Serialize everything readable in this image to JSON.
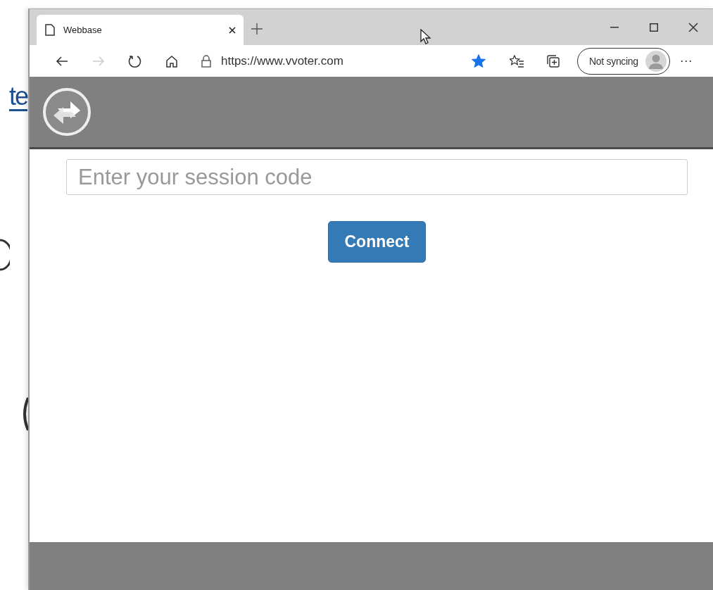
{
  "background_page": {
    "link_text": "te"
  },
  "browser": {
    "tabs": [
      {
        "title": "Webbase",
        "selected": true
      }
    ],
    "address": "https://www.vvoter.com",
    "favorite": true,
    "sync_button": "Not syncing",
    "more_button": "···"
  },
  "app": {
    "session_field": {
      "placeholder": "Enter your session code"
    },
    "connect_button": "Connect"
  }
}
